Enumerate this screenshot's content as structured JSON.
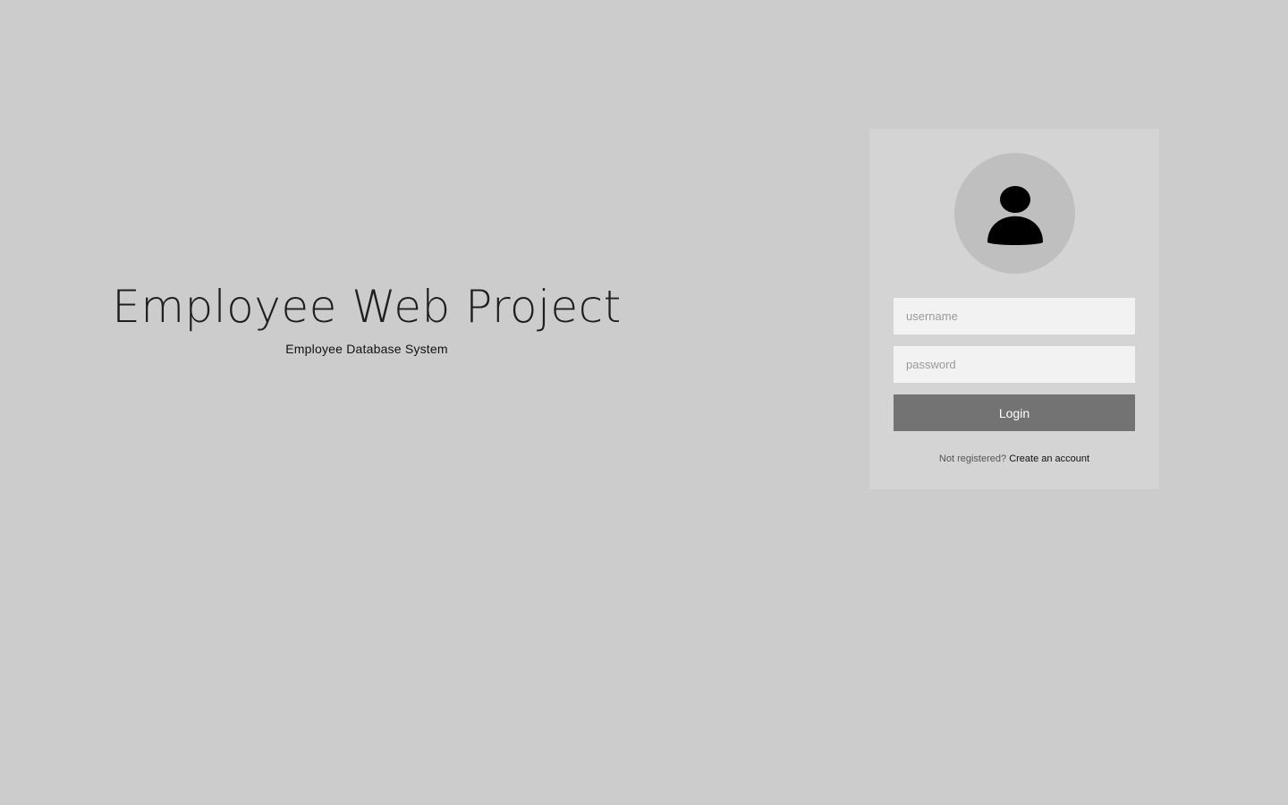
{
  "brand": {
    "title": "Employee Web Project",
    "subtitle": "Employee Database System"
  },
  "login": {
    "avatar_icon": "user-silhouette-icon",
    "username_placeholder": "username",
    "password_placeholder": "password",
    "username_value": "",
    "password_value": "",
    "login_label": "Login",
    "register_prompt": "Not registered?",
    "register_link": "Create an account"
  },
  "colors": {
    "page_background": "#cccccc",
    "card_background": "#d4d4d4",
    "avatar_background": "#bfbfbf",
    "input_background": "#f2f2f2",
    "button_background": "#737373",
    "button_text": "#ffffff"
  }
}
